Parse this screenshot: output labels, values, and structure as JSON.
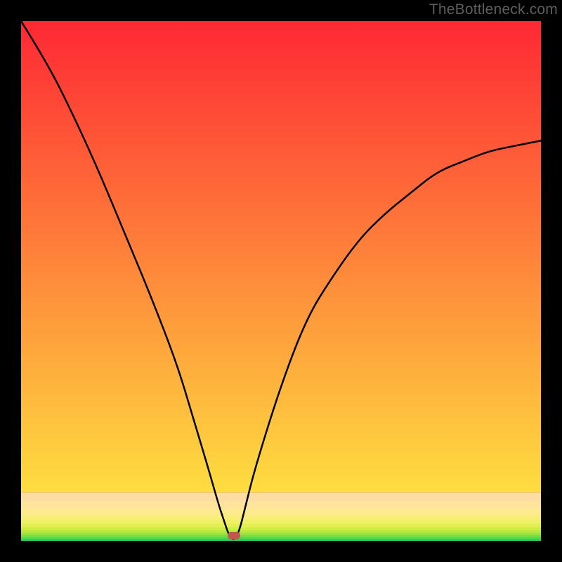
{
  "watermark": "TheBottleneck.com",
  "chart_data": {
    "type": "line",
    "title": "",
    "xlabel": "",
    "ylabel": "",
    "xlim": [
      0,
      100
    ],
    "ylim": [
      0,
      100
    ],
    "grid": false,
    "legend": false,
    "background_bands": [
      {
        "ratio": 0.002,
        "color": "#1ec853"
      },
      {
        "ratio": 0.003,
        "color": "#37cf4e"
      },
      {
        "ratio": 0.003,
        "color": "#57d649"
      },
      {
        "ratio": 0.004,
        "color": "#78dd45"
      },
      {
        "ratio": 0.004,
        "color": "#98e342"
      },
      {
        "ratio": 0.005,
        "color": "#b6e841"
      },
      {
        "ratio": 0.006,
        "color": "#cfec45"
      },
      {
        "ratio": 0.007,
        "color": "#e3ef53"
      },
      {
        "ratio": 0.008,
        "color": "#f0f066"
      },
      {
        "ratio": 0.009,
        "color": "#f9ee7b"
      },
      {
        "ratio": 0.012,
        "color": "#fdea8f"
      },
      {
        "ratio": 0.014,
        "color": "#fee49d"
      },
      {
        "ratio": 0.016,
        "color": "#fddda2"
      },
      {
        "ratio": 0.904,
        "color_gradient_from": "#fede40",
        "color_gradient_to": "#fe2834"
      }
    ],
    "marker": {
      "x": 41,
      "y": 1.1,
      "color": "#c1584e"
    },
    "series": [
      {
        "name": "curve",
        "color": "#000000",
        "width": 2.5,
        "x": [
          0,
          5,
          10,
          15,
          20,
          25,
          30,
          33,
          36,
          38,
          39,
          40,
          41,
          42,
          43,
          45,
          50,
          55,
          60,
          65,
          70,
          75,
          80,
          85,
          90,
          95,
          100
        ],
        "values": [
          100,
          92,
          82,
          71,
          59,
          47,
          34,
          24,
          14,
          7,
          4,
          1,
          0,
          2,
          6,
          14,
          30,
          43,
          51,
          58,
          63,
          67,
          71,
          73,
          75,
          76,
          77
        ]
      }
    ]
  }
}
